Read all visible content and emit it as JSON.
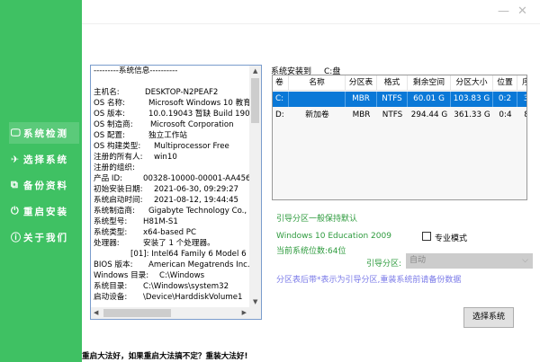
{
  "sidebar": {
    "items": [
      {
        "icon": "monitor-icon",
        "glyph": "🖵",
        "label": "系统检测",
        "active": true
      },
      {
        "icon": "rocket-icon",
        "glyph": "✈",
        "label": "选择系统"
      },
      {
        "icon": "copy-icon",
        "glyph": "⧉",
        "label": "备份资料"
      },
      {
        "icon": "power-icon",
        "glyph": "⏻",
        "label": "重启安装"
      },
      {
        "icon": "info-icon",
        "glyph": "ⓘ",
        "label": "关于我们"
      }
    ]
  },
  "window": {
    "minimize": "—",
    "close": "✕"
  },
  "sysinfo": {
    "header": "---------系统信息----------",
    "rows": [
      {
        "k": "主机名:",
        "v": "DESKTOP-N2PEAF2"
      },
      {
        "k": "OS 名称:",
        "v": "Microsoft Windows 10 教育"
      },
      {
        "k": "OS 版本:",
        "v": "10.0.19043 暂缺 Build 1904"
      },
      {
        "k": "OS 制造商:",
        "v": "Microsoft Corporation"
      },
      {
        "k": "OS 配置:",
        "v": "独立工作站"
      },
      {
        "k": "OS 构建类型:",
        "v": "Multiprocessor Free"
      },
      {
        "k": "注册的所有人:",
        "v": "win10"
      },
      {
        "k": "注册的组织:",
        "v": ""
      },
      {
        "k": "产品 ID:",
        "v": "00328-10000-00001-AA456"
      },
      {
        "k": "初始安装日期:",
        "v": "2021-06-30, 09:29:27"
      },
      {
        "k": "系统启动时间:",
        "v": "2021-08-12, 19:44:45"
      },
      {
        "k": "系统制造商:",
        "v": "Gigabyte Technology Co.,"
      },
      {
        "k": "系统型号:",
        "v": "H81M-S1"
      },
      {
        "k": "系统类型:",
        "v": "x64-based PC"
      },
      {
        "k": "处理器:",
        "v": "安装了 1 个处理器。"
      },
      {
        "k": "",
        "v": "[01]: Intel64 Family 6 Model 6"
      },
      {
        "k": "BIOS 版本:",
        "v": "American Megatrends Inc."
      },
      {
        "k": "Windows 目录:",
        "v": "C:\\Windows"
      },
      {
        "k": "系统目录:",
        "v": "C:\\Windows\\system32"
      },
      {
        "k": "启动设备:",
        "v": "\\Device\\HarddiskVolume1"
      }
    ]
  },
  "install": {
    "label": "系统安装到",
    "drive": "C:盘"
  },
  "table": {
    "headers": [
      "卷",
      "名称",
      "分区表",
      "格式",
      "剩余空间",
      "分区大小",
      "位置",
      "序"
    ],
    "rows": [
      [
        "C:",
        "",
        "MBR",
        "NTFS",
        "60.01 G",
        "103.83 G",
        "0:2",
        "3"
      ],
      [
        "D:",
        "新加卷",
        "MBR",
        "NTFS",
        "294.44 G",
        "361.33 G",
        "0:4",
        "8"
      ]
    ]
  },
  "boot_hint": "引导分区一般保持默认",
  "os_version": "Windows 10 Education  2009",
  "bits": "当前系统位数:64位",
  "pro_mode": "专业模式",
  "boot_partition_label": "引导分区:",
  "boot_partition_value": "自动",
  "note": "分区表后带*表示为引导分区,重装系统前请备份数据",
  "select_button": "选择系统",
  "footer": "重启大法好，如果重启大法搞不定？重装大法好!"
}
